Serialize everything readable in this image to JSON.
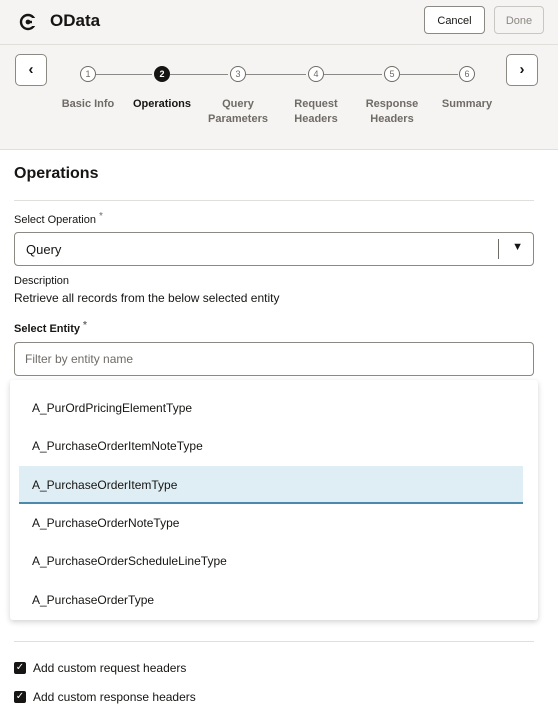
{
  "header": {
    "title": "OData",
    "cancel_label": "Cancel",
    "done_label": "Done"
  },
  "steps": [
    {
      "num": "1",
      "label": "Basic Info"
    },
    {
      "num": "2",
      "label": "Operations"
    },
    {
      "num": "3",
      "label": "Query Parameters"
    },
    {
      "num": "4",
      "label": "Request Headers"
    },
    {
      "num": "5",
      "label": "Response Headers"
    },
    {
      "num": "6",
      "label": "Summary"
    }
  ],
  "nav": {
    "prev_icon": "chevron-left-icon",
    "next_icon": "chevron-right-icon"
  },
  "section": {
    "title": "Operations"
  },
  "operation": {
    "label": "Select Operation",
    "required_mark": "*",
    "value": "Query"
  },
  "description": {
    "label": "Description",
    "text": "Retrieve all records from the below selected entity"
  },
  "entity": {
    "label": "Select Entity",
    "required_mark": "*",
    "placeholder": "Filter by entity name",
    "options": [
      "A_PurOrdPricingElementType",
      "A_PurchaseOrderItemNoteType",
      "A_PurchaseOrderItemType",
      "A_PurchaseOrderNoteType",
      "A_PurchaseOrderScheduleLineType",
      "A_PurchaseOrderType"
    ]
  },
  "checkboxes": {
    "request_headers": "Add custom request headers",
    "response_headers": "Add custom response headers"
  },
  "colors": {
    "accent": "#161513",
    "selected_bg": "#dfeef5",
    "selected_border": "#4d89a8"
  }
}
